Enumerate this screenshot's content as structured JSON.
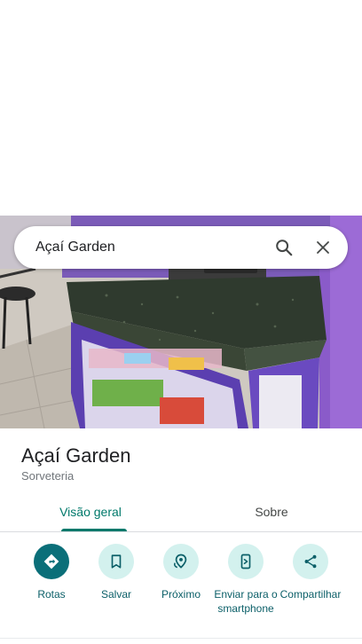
{
  "search": {
    "value": "Açaí Garden"
  },
  "place": {
    "name": "Açaí Garden",
    "category": "Sorveteria"
  },
  "tabs": [
    {
      "label": "Visão geral",
      "active": true
    },
    {
      "label": "Sobre",
      "active": false
    }
  ],
  "actions": [
    {
      "label": "Rotas",
      "icon": "directions-icon",
      "primary": true
    },
    {
      "label": "Salvar",
      "icon": "bookmark-icon",
      "primary": false
    },
    {
      "label": "Próximo",
      "icon": "nearby-icon",
      "primary": false
    },
    {
      "label": "Enviar para o smartphone",
      "icon": "send-to-phone-icon",
      "primary": false
    },
    {
      "label": "Compartilhar",
      "icon": "share-icon",
      "primary": false
    }
  ],
  "colors": {
    "accent": "#00796b",
    "action_bg": "#d3f1ee",
    "primary_action_bg": "#0b6f79"
  }
}
